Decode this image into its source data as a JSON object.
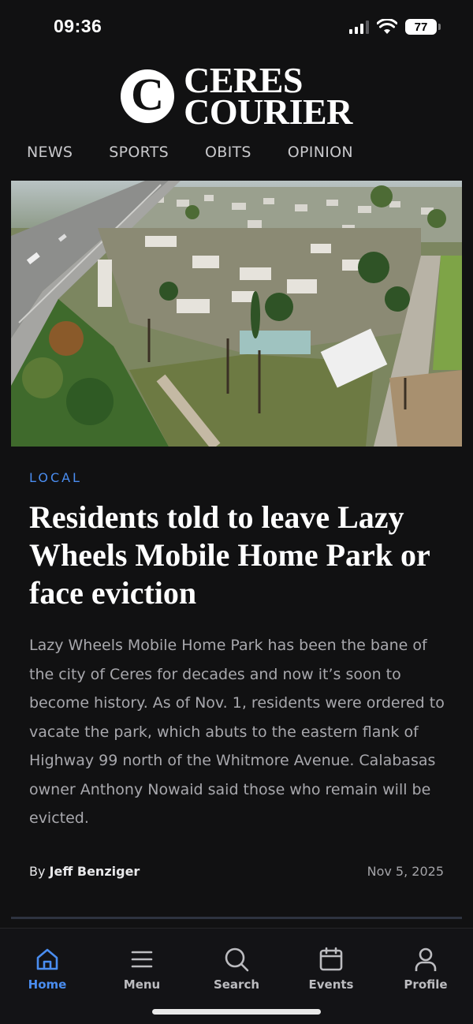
{
  "status_bar": {
    "time": "09:36",
    "battery": "77"
  },
  "masthead": {
    "logo_letter": "C",
    "line1": "CERES",
    "line2": "COURIER"
  },
  "nav": {
    "items": [
      "NEWS",
      "SPORTS",
      "OBITS",
      "OPINION"
    ]
  },
  "article": {
    "category": "LOCAL",
    "headline": "Residents told to leave Lazy Wheels Mobile Home Park or face eviction",
    "summary": "Lazy Wheels Mobile Home Park has been the bane of the city of Ceres for decades and now it’s soon to become history. As of Nov. 1, residents were ordered to vacate the park, which abuts to the eastern flank of Highway 99 north of the Whitmore Avenue. Calabasas owner Anthony Nowaid said those who remain will be evicted.",
    "byline_prefix": "By",
    "author": "Jeff Benziger",
    "date": "Nov 5, 2025"
  },
  "tabbar": {
    "tabs": [
      {
        "label": "Home",
        "icon": "home-icon",
        "active": true
      },
      {
        "label": "Menu",
        "icon": "menu-icon",
        "active": false
      },
      {
        "label": "Search",
        "icon": "search-icon",
        "active": false
      },
      {
        "label": "Events",
        "icon": "calendar-icon",
        "active": false
      },
      {
        "label": "Profile",
        "icon": "profile-icon",
        "active": false
      }
    ]
  },
  "colors": {
    "accent": "#4a8df0",
    "background": "#111112",
    "text": "#ffffff",
    "muted": "#a8a8ad"
  }
}
